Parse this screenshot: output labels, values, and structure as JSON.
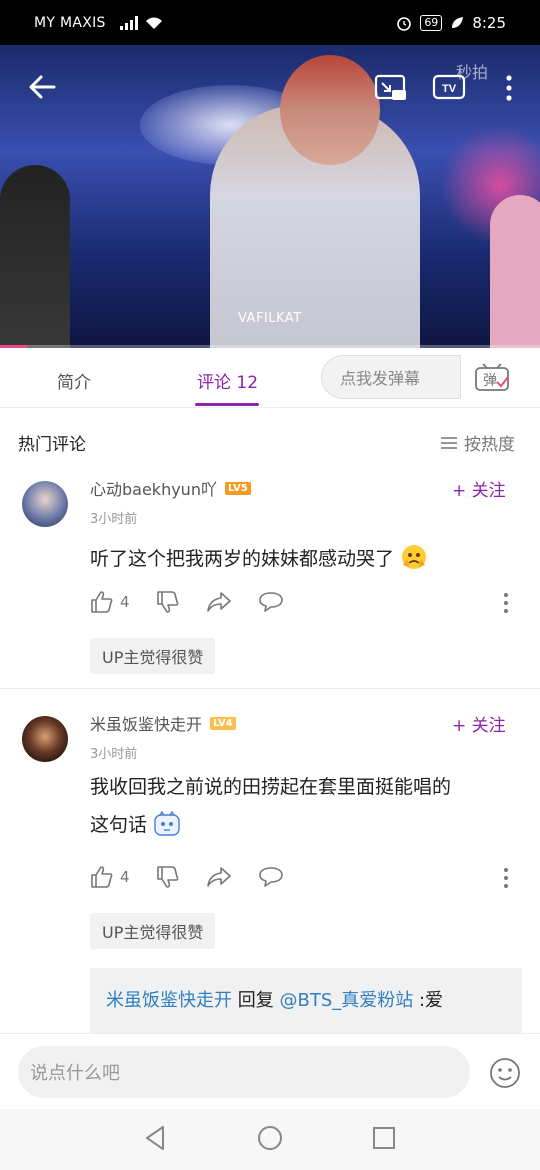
{
  "status_bar": {
    "carrier": "MY MAXIS",
    "battery": "69",
    "time": "8:25"
  },
  "video": {
    "watermark": "VAFILKAT",
    "app_logo": "秒拍",
    "progress_percent": 5
  },
  "tabs": [
    {
      "label": "简介"
    },
    {
      "label": "评论 12"
    }
  ],
  "danmaku": {
    "placeholder": "点我发弹幕",
    "button_label": "弹"
  },
  "comments_section": {
    "title": "热门评论",
    "sort_label": "按热度"
  },
  "comments": [
    {
      "user": "心动baekhyun吖",
      "level": "LV5",
      "follow_label": "+ 关注",
      "time": "3小时前",
      "text": "听了这个把我两岁的妹妹都感动哭了",
      "likes": "4",
      "tag": "UP主觉得很赞"
    },
    {
      "user": "米虽饭鉴快走开",
      "level": "LV4",
      "follow_label": "+ 关注",
      "time": "3小时前",
      "text_line1": "我收回我之前说的田捞起在套里面挺能唱的",
      "text_line2": "这句话",
      "likes": "4",
      "tag": "UP主觉得很赞",
      "reply": {
        "from": "米虽饭鉴快走开",
        "verb": "回复",
        "to": "@BTS_真爱粉站",
        "text": ":爱"
      }
    }
  ],
  "bottom_bar": {
    "placeholder": "说点什么吧"
  },
  "colors": {
    "accent": "#8e24aa",
    "link": "#2f7fc1"
  }
}
